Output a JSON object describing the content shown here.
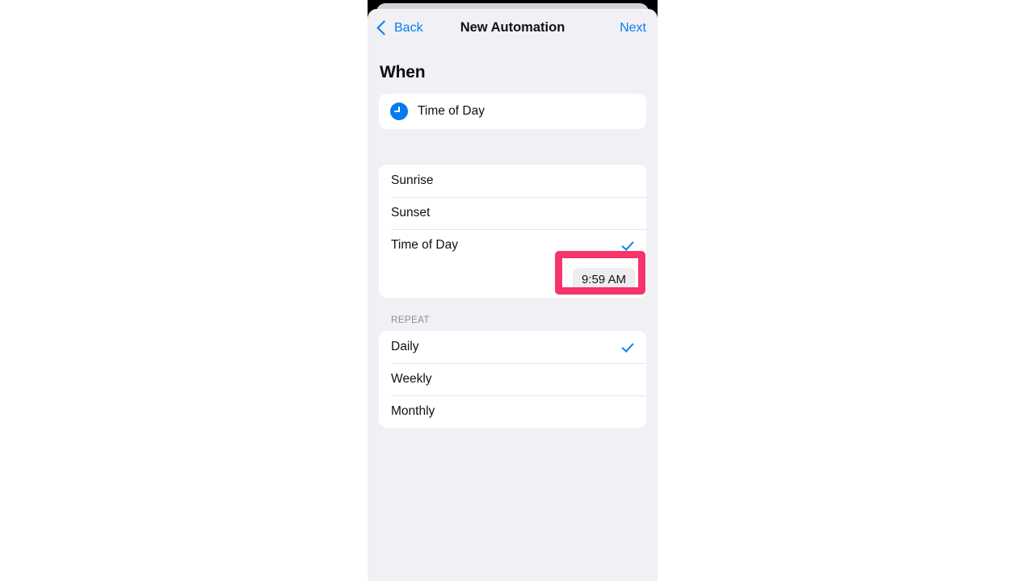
{
  "nav": {
    "back_label": "Back",
    "title": "New Automation",
    "next_label": "Next"
  },
  "when": {
    "section_title": "When",
    "trigger": {
      "icon": "clock-icon",
      "label": "Time of Day"
    },
    "options": [
      {
        "label": "Sunrise",
        "checked": false
      },
      {
        "label": "Sunset",
        "checked": false
      },
      {
        "label": "Time of Day",
        "checked": true
      }
    ],
    "time_value": "9:59 AM"
  },
  "repeat": {
    "header": "REPEAT",
    "options": [
      {
        "label": "Daily",
        "checked": true
      },
      {
        "label": "Weekly",
        "checked": false
      },
      {
        "label": "Monthly",
        "checked": false
      }
    ]
  },
  "colors": {
    "accent_blue": "#0a7cf1",
    "check_blue": "#0a84e8",
    "annotation_pink": "#f6336a",
    "sheet_background": "#f1f0f5",
    "card_background": "#ffffff"
  }
}
